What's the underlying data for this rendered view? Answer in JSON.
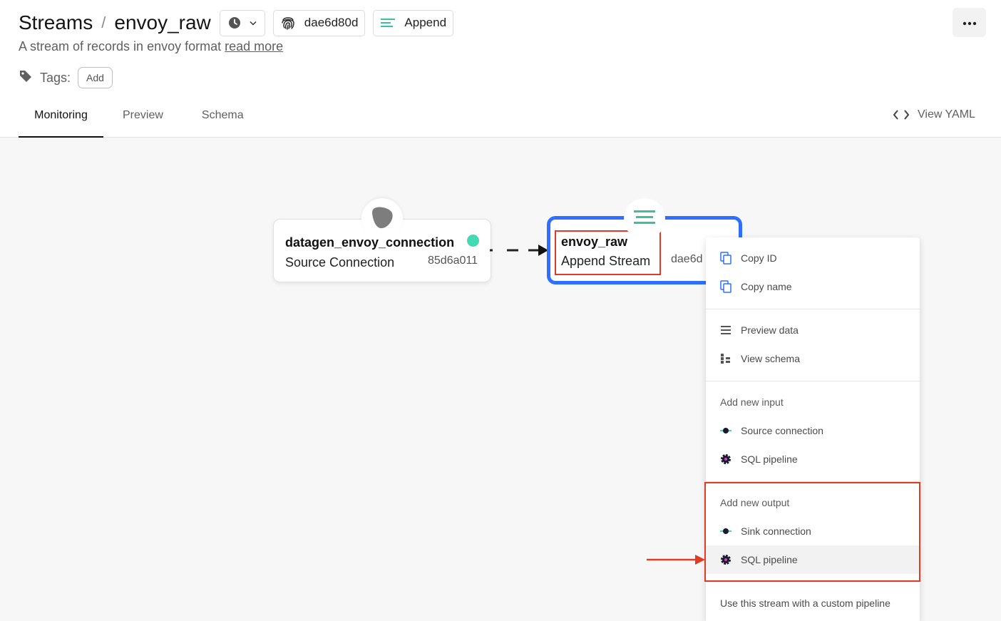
{
  "header": {
    "breadcrumb_root": "Streams",
    "breadcrumb_sep": "/",
    "stream_name": "envoy_raw",
    "id_chip": "dae6d80d",
    "type_chip": "Append",
    "description": "A stream of records in envoy format",
    "read_more": "read more",
    "tags_label": "Tags:",
    "add_tag": "Add"
  },
  "tabs": [
    {
      "label": "Monitoring",
      "active": true
    },
    {
      "label": "Preview",
      "active": false
    },
    {
      "label": "Schema",
      "active": false
    }
  ],
  "view_yaml": "View YAML",
  "graph": {
    "source": {
      "name": "datagen_envoy_connection",
      "type": "Source Connection",
      "id": "85d6a011",
      "status_color": "#43d9b3"
    },
    "stream": {
      "name": "envoy_raw",
      "type": "Append Stream",
      "id_partial": "dae6d"
    }
  },
  "menu": {
    "copy_id": "Copy ID",
    "copy_name": "Copy name",
    "preview_data": "Preview data",
    "view_schema": "View schema",
    "add_input_header": "Add new input",
    "input_source_connection": "Source connection",
    "input_sql_pipeline": "SQL pipeline",
    "add_output_header": "Add new output",
    "output_sink_connection": "Sink connection",
    "output_sql_pipeline": "SQL pipeline",
    "custom_pipeline": "Use this stream with a custom pipeline"
  },
  "colors": {
    "accent_blue": "#2f6fff",
    "highlight_red": "#e03b24",
    "teal": "#43d9b3",
    "copy_icon_blue": "#2f6fff"
  }
}
